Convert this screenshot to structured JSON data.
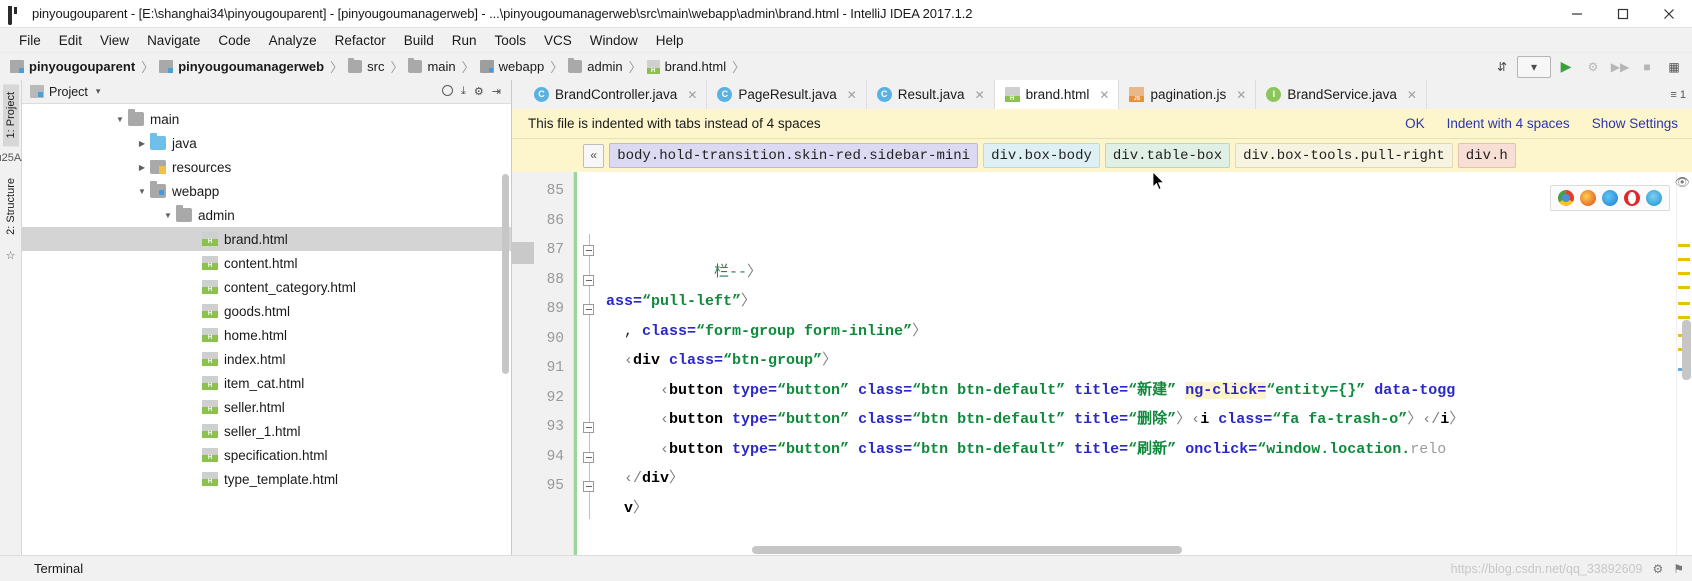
{
  "window": {
    "title": "pinyougouparent - [E:\\shanghai34\\pinyougouparent] - [pinyougoumanagerweb] - ...\\pinyougoumanagerweb\\src\\main\\webapp\\admin\\brand.html - IntelliJ IDEA 2017.1.2",
    "app_icon": "intellij-idea-icon",
    "minimize": "–",
    "maximize": "❐",
    "close": "✕"
  },
  "menubar": {
    "items": [
      {
        "label": "File"
      },
      {
        "label": "Edit"
      },
      {
        "label": "View"
      },
      {
        "label": "Navigate"
      },
      {
        "label": "Code"
      },
      {
        "label": "Analyze"
      },
      {
        "label": "Refactor"
      },
      {
        "label": "Build"
      },
      {
        "label": "Run"
      },
      {
        "label": "Tools"
      },
      {
        "label": "VCS"
      },
      {
        "label": "Window"
      },
      {
        "label": "Help"
      }
    ]
  },
  "navbar": {
    "crumbs": [
      {
        "label": "pinyougouparent",
        "icon": "module-icon",
        "bold": true
      },
      {
        "label": "pinyougoumanagerweb",
        "icon": "module-icon",
        "bold": true
      },
      {
        "label": "src",
        "icon": "folder-icon",
        "bold": false
      },
      {
        "label": "main",
        "icon": "folder-icon",
        "bold": false
      },
      {
        "label": "webapp",
        "icon": "source-folder-icon",
        "bold": false
      },
      {
        "label": "admin",
        "icon": "folder-icon",
        "bold": false
      },
      {
        "label": "brand.html",
        "icon": "html-file-icon",
        "bold": false
      }
    ],
    "separator": "〉",
    "tools": [
      {
        "name": "sort-icon",
        "glyph": "⇵"
      },
      {
        "name": "run-config-dropdown",
        "glyph": "▾"
      },
      {
        "name": "run-icon",
        "glyph": "▶"
      },
      {
        "name": "debug-icon",
        "glyph": "⚙"
      },
      {
        "name": "coverage-icon",
        "glyph": "▶▶"
      },
      {
        "name": "stop-icon",
        "glyph": "■"
      },
      {
        "name": "layout-icon",
        "glyph": "▦"
      }
    ]
  },
  "left_rail": {
    "tabs": [
      {
        "label": "1: Project",
        "active": true
      },
      {
        "label": "2: Structure",
        "active": false
      },
      {
        "label": "7: Favorites",
        "active": false
      }
    ]
  },
  "project_panel": {
    "title": "Project",
    "caret": "▾",
    "tools": [
      {
        "name": "scope-icon",
        "glyph": "◎"
      },
      {
        "name": "collapse-all-icon",
        "glyph": "⤓"
      },
      {
        "name": "settings-gear-icon",
        "glyph": "⚙"
      },
      {
        "name": "hide-panel-icon",
        "glyph": "⇥"
      }
    ],
    "tree": [
      {
        "label": "main",
        "icon": "folder-icon",
        "arrow": "down",
        "indent": 1,
        "selected": false
      },
      {
        "label": "java",
        "icon": "source-root-icon",
        "arrow": "right",
        "indent": 2,
        "selected": false
      },
      {
        "label": "resources",
        "icon": "resources-folder-icon",
        "arrow": "right",
        "indent": 2,
        "selected": false
      },
      {
        "label": "webapp",
        "icon": "webapp-folder-icon",
        "arrow": "down",
        "indent": 2,
        "selected": false
      },
      {
        "label": "admin",
        "icon": "folder-icon",
        "arrow": "down",
        "indent": 3,
        "selected": false
      },
      {
        "label": "brand.html",
        "icon": "html-file-icon",
        "arrow": "none",
        "indent": 4,
        "selected": true
      },
      {
        "label": "content.html",
        "icon": "html-file-icon",
        "arrow": "none",
        "indent": 4,
        "selected": false
      },
      {
        "label": "content_category.html",
        "icon": "html-file-icon",
        "arrow": "none",
        "indent": 4,
        "selected": false
      },
      {
        "label": "goods.html",
        "icon": "html-file-icon",
        "arrow": "none",
        "indent": 4,
        "selected": false
      },
      {
        "label": "home.html",
        "icon": "html-file-icon",
        "arrow": "none",
        "indent": 4,
        "selected": false
      },
      {
        "label": "index.html",
        "icon": "html-file-icon",
        "arrow": "none",
        "indent": 4,
        "selected": false
      },
      {
        "label": "item_cat.html",
        "icon": "html-file-icon",
        "arrow": "none",
        "indent": 4,
        "selected": false
      },
      {
        "label": "seller.html",
        "icon": "html-file-icon",
        "arrow": "none",
        "indent": 4,
        "selected": false
      },
      {
        "label": "seller_1.html",
        "icon": "html-file-icon",
        "arrow": "none",
        "indent": 4,
        "selected": false
      },
      {
        "label": "specification.html",
        "icon": "html-file-icon",
        "arrow": "none",
        "indent": 4,
        "selected": false
      },
      {
        "label": "type_template.html",
        "icon": "html-file-icon",
        "arrow": "none",
        "indent": 4,
        "selected": false
      }
    ]
  },
  "editor_tabs": {
    "tabs": [
      {
        "label": "BrandController.java",
        "icon": "java-class-icon",
        "badge": "C",
        "active": false,
        "close": "✕"
      },
      {
        "label": "PageResult.java",
        "icon": "java-class-icon",
        "badge": "C",
        "active": false,
        "close": "✕"
      },
      {
        "label": "Result.java",
        "icon": "java-class-icon",
        "badge": "C",
        "active": false,
        "close": "✕"
      },
      {
        "label": "brand.html",
        "icon": "html-file-icon",
        "badge": "",
        "active": true,
        "close": "✕"
      },
      {
        "label": "pagination.js",
        "icon": "js-file-icon",
        "badge": "",
        "active": false,
        "close": "✕"
      },
      {
        "label": "BrandService.java",
        "icon": "java-interface-icon",
        "badge": "I",
        "active": false,
        "close": "✕"
      }
    ],
    "overflow": "≡ 1"
  },
  "notification": {
    "message": "This file is indented with tabs instead of 4 spaces",
    "actions": [
      {
        "label": "OK",
        "name": "notification-ok-link"
      },
      {
        "label": "Indent with 4 spaces",
        "name": "notification-indent-link"
      },
      {
        "label": "Show Settings",
        "name": "notification-show-settings-link"
      }
    ]
  },
  "breadcrumb_bar": {
    "collapse_label": "«",
    "items": [
      {
        "label": "body.hold-transition.skin-red.sidebar-mini",
        "color": "purple"
      },
      {
        "label": "div.box-body",
        "color": "blue"
      },
      {
        "label": "div.table-box",
        "color": "green"
      },
      {
        "label": "div.box-tools.pull-right",
        "color": "yellow"
      },
      {
        "label": "div.h",
        "color": "pink"
      }
    ]
  },
  "code": {
    "lines": [
      {
        "number": "85",
        "fold": "none",
        "segments": []
      },
      {
        "number": "86",
        "fold": "none",
        "segments": [
          {
            "t": "            ",
            "c": "tok-plain"
          },
          {
            "t": "栏--",
            "c": "tok-comment"
          },
          {
            "t": "〉",
            "c": "tok-ang"
          }
        ]
      },
      {
        "number": "87",
        "fold": "open",
        "segments": [
          {
            "t": "ass=",
            "c": "tok-attr"
          },
          {
            "t": "“pull-left”",
            "c": "tok-val"
          },
          {
            "t": "〉",
            "c": "tok-ang"
          }
        ]
      },
      {
        "number": "88",
        "fold": "open",
        "segments": [
          {
            "t": "  , ",
            "c": "tok-plain"
          },
          {
            "t": "class=",
            "c": "tok-attr"
          },
          {
            "t": "“form-group form-inline”",
            "c": "tok-val"
          },
          {
            "t": "〉",
            "c": "tok-ang"
          }
        ]
      },
      {
        "number": "89",
        "fold": "open",
        "segments": [
          {
            "t": "  ‹",
            "c": "tok-ang"
          },
          {
            "t": "div ",
            "c": "tok-tag"
          },
          {
            "t": "class=",
            "c": "tok-attr"
          },
          {
            "t": "“btn-group”",
            "c": "tok-val"
          },
          {
            "t": "〉",
            "c": "tok-ang"
          }
        ]
      },
      {
        "number": "90",
        "fold": "none",
        "segments": [
          {
            "t": "      ‹",
            "c": "tok-ang"
          },
          {
            "t": "button ",
            "c": "tok-tag"
          },
          {
            "t": "type=",
            "c": "tok-attr"
          },
          {
            "t": "“button”",
            "c": "tok-val"
          },
          {
            "t": " ",
            "c": "tok-plain"
          },
          {
            "t": "class=",
            "c": "tok-attr"
          },
          {
            "t": "“btn btn-default”",
            "c": "tok-val"
          },
          {
            "t": " ",
            "c": "tok-plain"
          },
          {
            "t": "title=",
            "c": "tok-attr"
          },
          {
            "t": "“新建”",
            "c": "tok-val"
          },
          {
            "t": " ",
            "c": "tok-plain"
          },
          {
            "t": "ng-click=",
            "c": "tok-attr hl-yellow"
          },
          {
            "t": "“entity={}”",
            "c": "tok-val"
          },
          {
            "t": " ",
            "c": "tok-plain"
          },
          {
            "t": "data-togg",
            "c": "tok-attr"
          }
        ]
      },
      {
        "number": "91",
        "fold": "none",
        "segments": [
          {
            "t": "      ‹",
            "c": "tok-ang"
          },
          {
            "t": "button ",
            "c": "tok-tag"
          },
          {
            "t": "type=",
            "c": "tok-attr"
          },
          {
            "t": "“button”",
            "c": "tok-val"
          },
          {
            "t": " ",
            "c": "tok-plain"
          },
          {
            "t": "class=",
            "c": "tok-attr"
          },
          {
            "t": "“btn btn-default”",
            "c": "tok-val"
          },
          {
            "t": " ",
            "c": "tok-plain"
          },
          {
            "t": "title=",
            "c": "tok-attr"
          },
          {
            "t": "“删除”",
            "c": "tok-val"
          },
          {
            "t": "〉‹",
            "c": "tok-ang"
          },
          {
            "t": "i ",
            "c": "tok-tag"
          },
          {
            "t": "class=",
            "c": "tok-attr"
          },
          {
            "t": "“fa fa-trash-o”",
            "c": "tok-val"
          },
          {
            "t": "〉‹/",
            "c": "tok-ang"
          },
          {
            "t": "i",
            "c": "tok-tag"
          },
          {
            "t": "〉",
            "c": "tok-ang"
          }
        ]
      },
      {
        "number": "92",
        "fold": "none",
        "segments": [
          {
            "t": "      ‹",
            "c": "tok-ang"
          },
          {
            "t": "button ",
            "c": "tok-tag"
          },
          {
            "t": "type=",
            "c": "tok-attr"
          },
          {
            "t": "“button”",
            "c": "tok-val"
          },
          {
            "t": " ",
            "c": "tok-plain"
          },
          {
            "t": "class=",
            "c": "tok-attr"
          },
          {
            "t": "“btn btn-default”",
            "c": "tok-val"
          },
          {
            "t": " ",
            "c": "tok-plain"
          },
          {
            "t": "title=",
            "c": "tok-attr"
          },
          {
            "t": "“刷新”",
            "c": "tok-val"
          },
          {
            "t": " ",
            "c": "tok-plain"
          },
          {
            "t": "onclick=",
            "c": "tok-attr"
          },
          {
            "t": "“window.location.",
            "c": "tok-val"
          },
          {
            "t": "relo",
            "c": "tok-gray"
          }
        ]
      },
      {
        "number": "93",
        "fold": "close",
        "segments": [
          {
            "t": "  ‹/",
            "c": "tok-ang"
          },
          {
            "t": "div",
            "c": "tok-tag"
          },
          {
            "t": "〉",
            "c": "tok-ang"
          }
        ]
      },
      {
        "number": "94",
        "fold": "close",
        "segments": [
          {
            "t": "  v",
            "c": "tok-tag"
          },
          {
            "t": "〉",
            "c": "tok-ang"
          }
        ]
      },
      {
        "number": "95",
        "fold": "close",
        "segments": []
      }
    ]
  },
  "browser_chips": {
    "items": [
      {
        "name": "chrome-browser-icon"
      },
      {
        "name": "firefox-browser-icon"
      },
      {
        "name": "edge-browser-icon"
      },
      {
        "name": "opera-browser-icon"
      },
      {
        "name": "internet-explorer-browser-icon"
      }
    ]
  },
  "statusbar": {
    "terminal_label": "Terminal",
    "watermark": "https://blog.csdn.net/qq_33892609",
    "icons": [
      {
        "name": "settings-gear-icon",
        "glyph": "⚙"
      },
      {
        "name": "notification-bell-icon",
        "glyph": "⚑"
      }
    ]
  },
  "colors": {
    "accent_blue": "#2b35af",
    "notification_bg": "#fdf6cd",
    "selection_gray": "#d4d4d4",
    "string_green": "#0f8a3c",
    "attr_blue": "#2a28c8"
  }
}
